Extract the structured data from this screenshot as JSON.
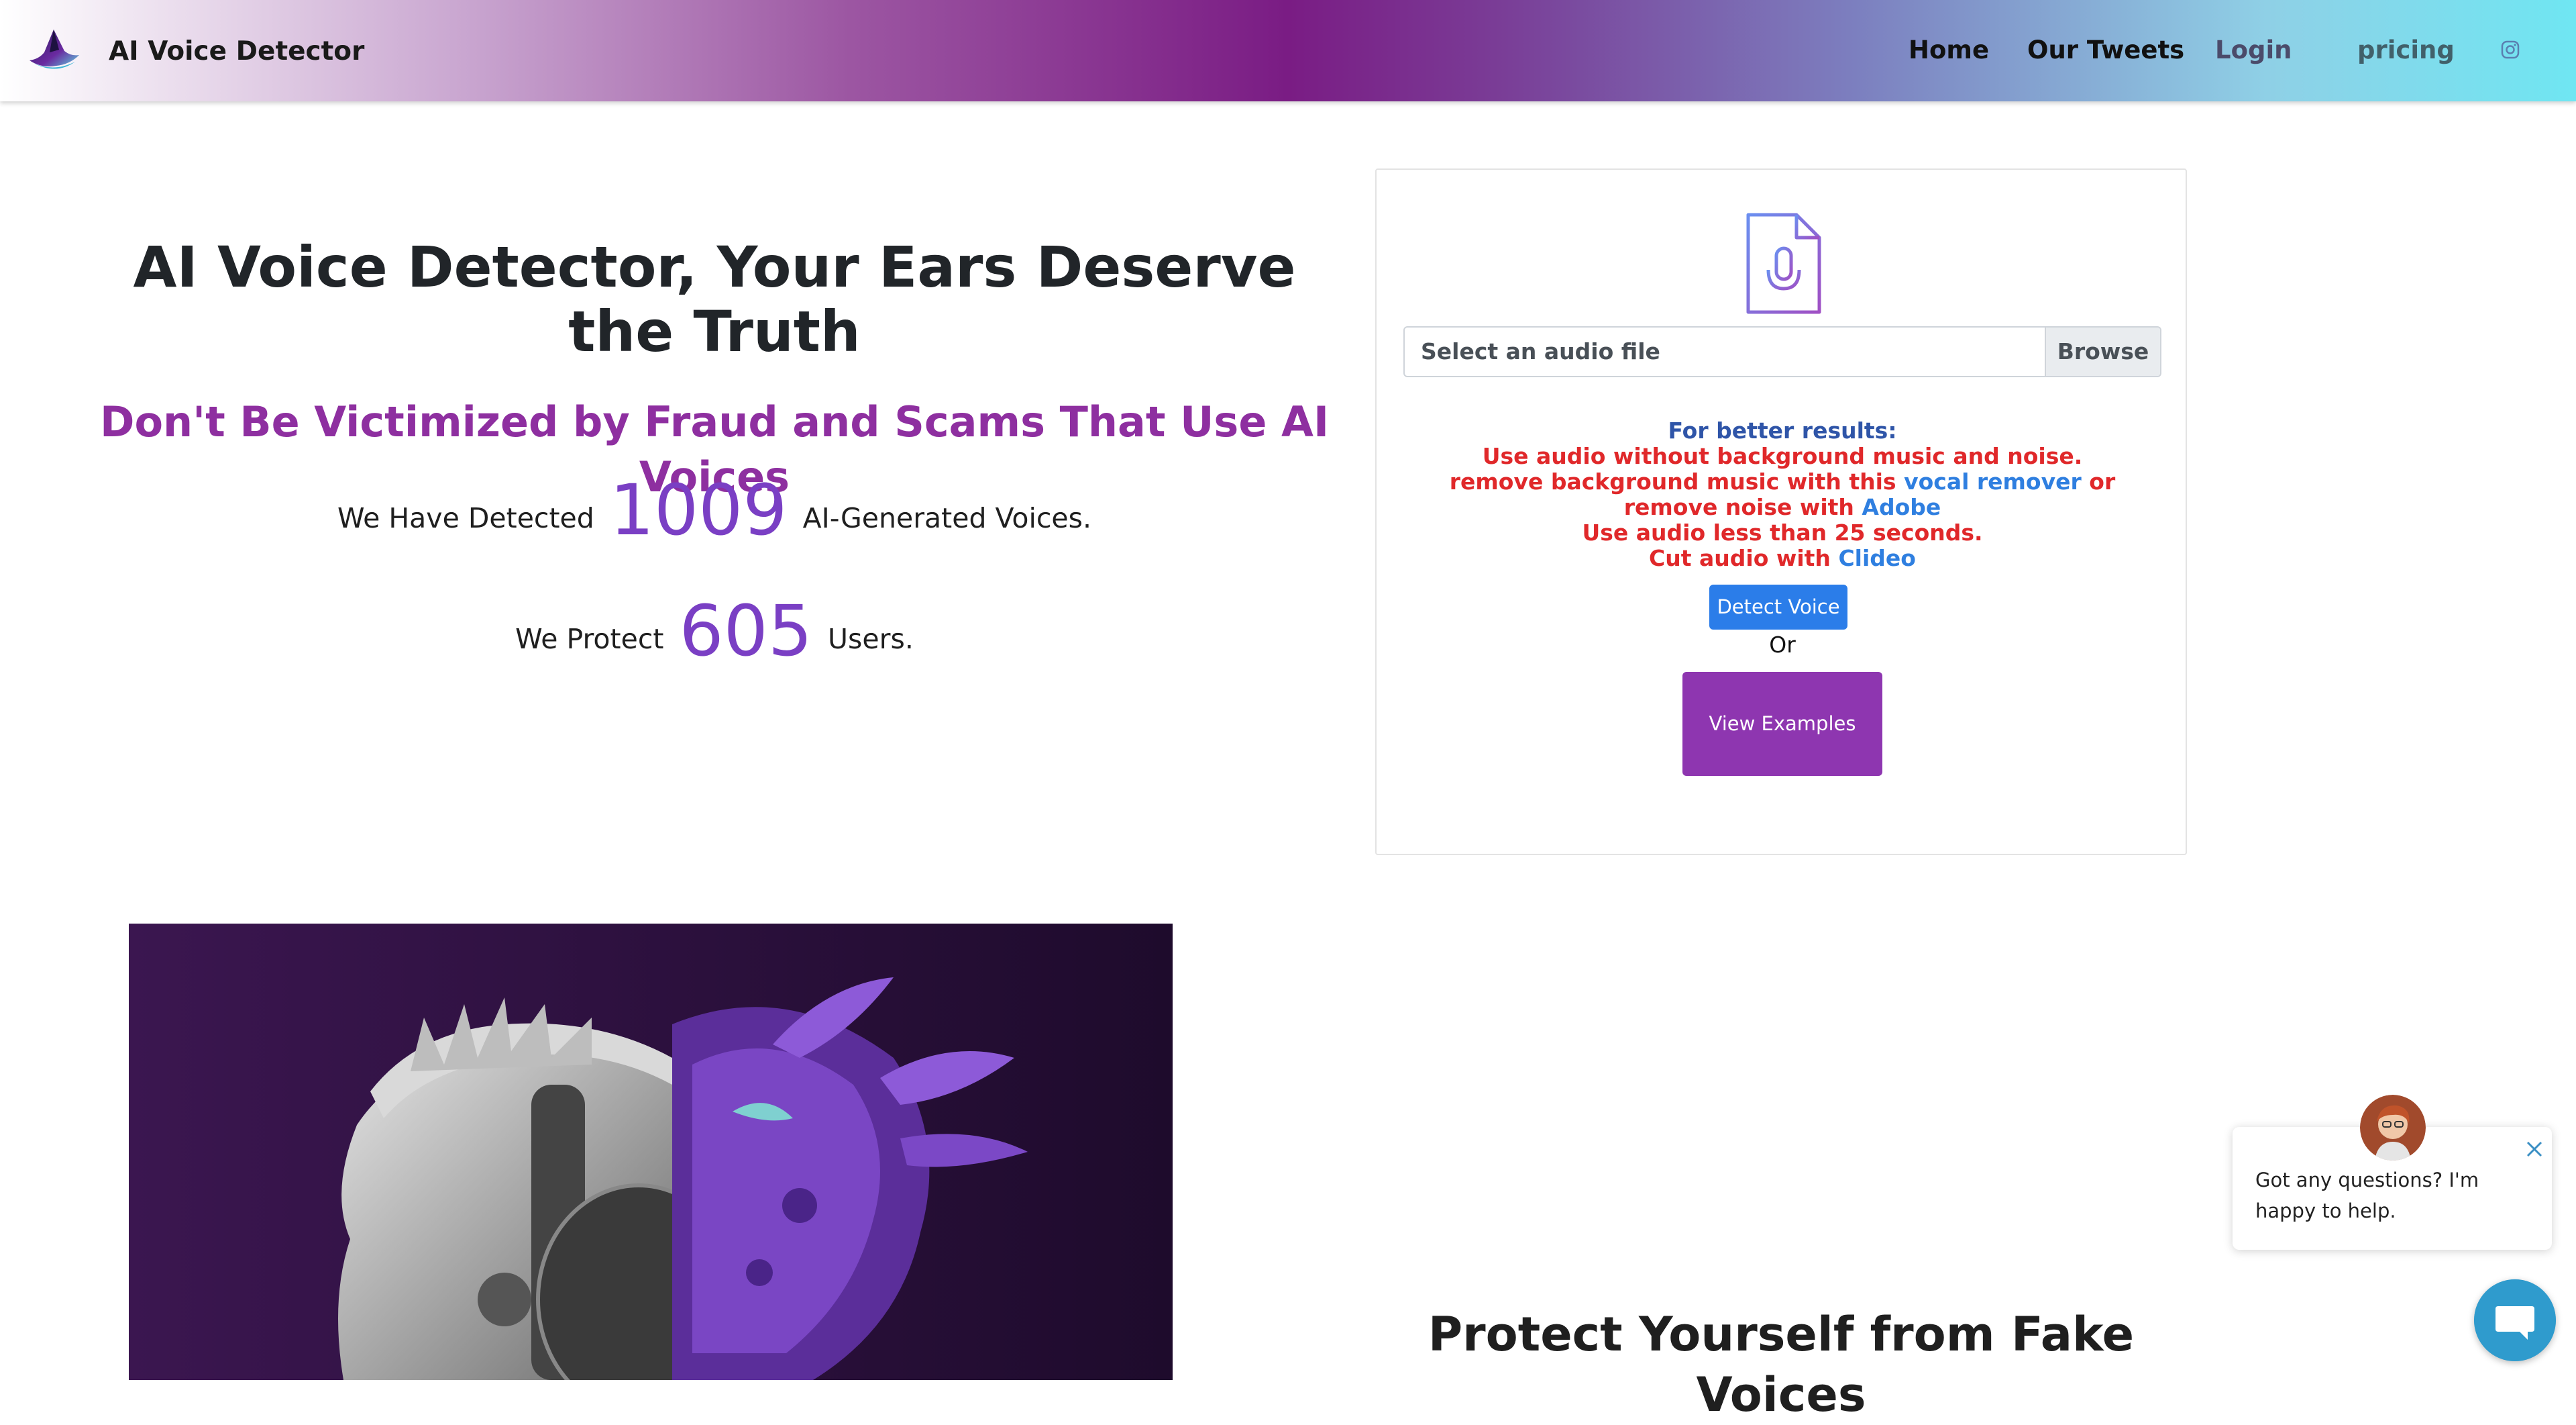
{
  "nav": {
    "brand": "AI Voice Detector",
    "items": [
      {
        "label": "Home"
      },
      {
        "label": "Our Tweets"
      },
      {
        "label": "Login"
      },
      {
        "label": "pricing"
      }
    ],
    "social_icon": "instagram-icon"
  },
  "hero": {
    "title": "AI Voice Detector, Your Ears Deserve the Truth",
    "subtitle": "Don't Be Victimized by Fraud and Scams That Use AI Voices",
    "detected_prefix": "We Have Detected",
    "detected_count": "1009",
    "detected_suffix": "AI-Generated Voices.",
    "protect_prefix": "We Protect",
    "protect_count": "605",
    "protect_suffix": "Users."
  },
  "upload": {
    "file_icon": "audio-file-icon",
    "placeholder": "Select an audio file",
    "browse": "Browse",
    "tips_heading": "For better results:",
    "tip1": "Use audio without background music and noise.",
    "tip2_pre": "remove background music with this",
    "tip2_link1": "vocal remover",
    "tip2_mid": "or remove noise with",
    "tip2_link2": "Adobe",
    "tip3": "Use audio less than 25 seconds.",
    "tip4_pre": "Cut audio with",
    "tip4_link": "Clideo",
    "detect_button": "Detect Voice",
    "or": "Or",
    "examples_button": "View Examples"
  },
  "section2": {
    "title": "Protect Yourself from Fake Voices"
  },
  "chat": {
    "message": "Got any questions? I'm happy to help."
  },
  "colors": {
    "accent_purple": "#7a3fc4",
    "subtitle_purple": "#8e2fa0",
    "button_blue": "#2b7de9",
    "button_purple": "#8e36b0",
    "warning_red": "#e0282a"
  }
}
